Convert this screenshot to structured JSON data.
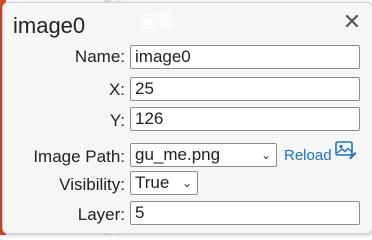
{
  "background": {
    "title": "画像"
  },
  "dialog": {
    "title": "image0",
    "close_glyph": "✕",
    "fields": {
      "name": {
        "label": "Name:",
        "value": "image0"
      },
      "x": {
        "label": "X:",
        "value": "25"
      },
      "y": {
        "label": "Y:",
        "value": "126"
      },
      "image_path": {
        "label": "Image Path:",
        "selected": "gu_me.png",
        "reload_label": "Reload"
      },
      "visibility": {
        "label": "Visibility:",
        "selected": "True"
      },
      "layer": {
        "label": "Layer:",
        "value": "5"
      }
    }
  },
  "icons": {
    "close": "close-icon",
    "image": "image-edit-icon",
    "dropdown": "chevron-down-icon"
  },
  "colors": {
    "accent": "#1a73c9",
    "left_bar": "#d9461f"
  }
}
